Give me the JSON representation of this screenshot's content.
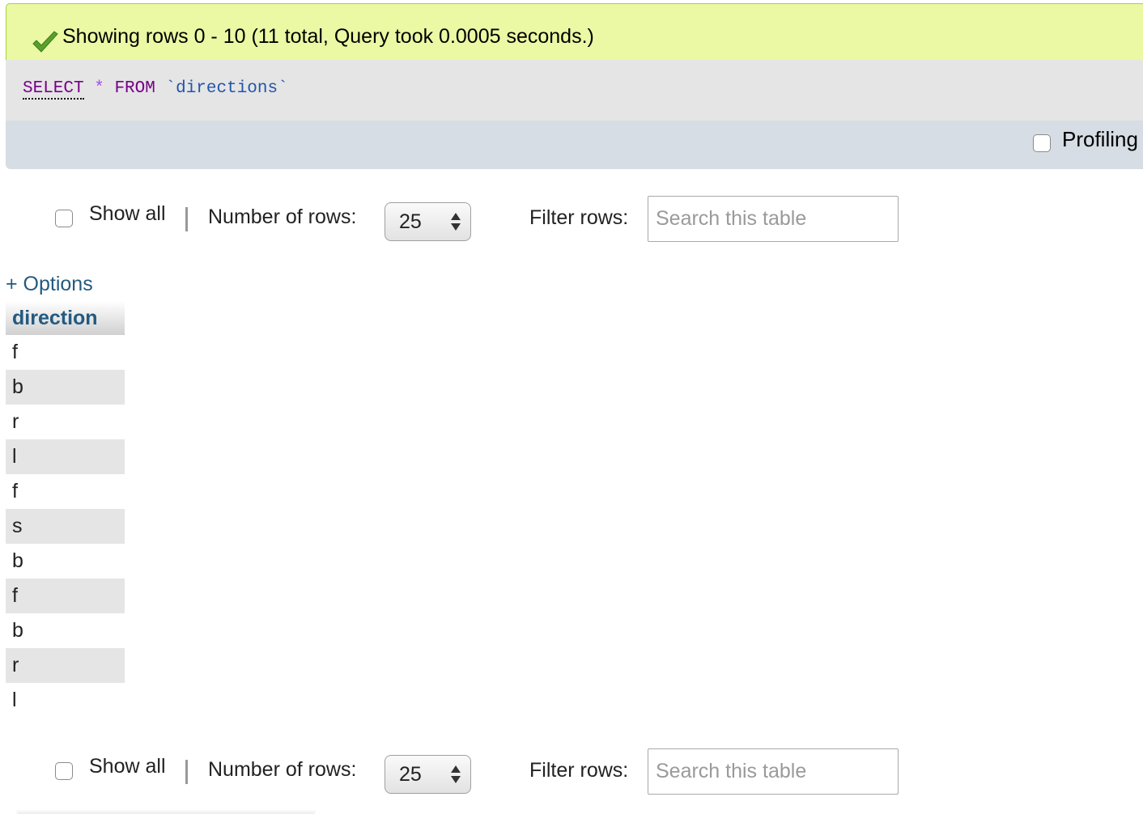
{
  "success": {
    "message": "Showing rows 0 - 10 (11 total, Query took 0.0005 seconds.)",
    "icon": "checkmark-icon",
    "color": "#ebf8a4"
  },
  "sql": {
    "select": "SELECT",
    "star": "*",
    "from": "FROM",
    "table": "`directions`"
  },
  "tools": {
    "profiling_label": "Profiling"
  },
  "navigation": {
    "show_all_label": "Show all",
    "separator": "|",
    "rows_label": "Number of rows:",
    "rows_value": "25",
    "filter_label": "Filter rows:",
    "search_placeholder": "Search this table"
  },
  "options_label": "+ Options",
  "table": {
    "header": "direction",
    "rows": [
      "f",
      "b",
      "r",
      "l",
      "f",
      "s",
      "b",
      "f",
      "b",
      "r",
      "l"
    ]
  }
}
